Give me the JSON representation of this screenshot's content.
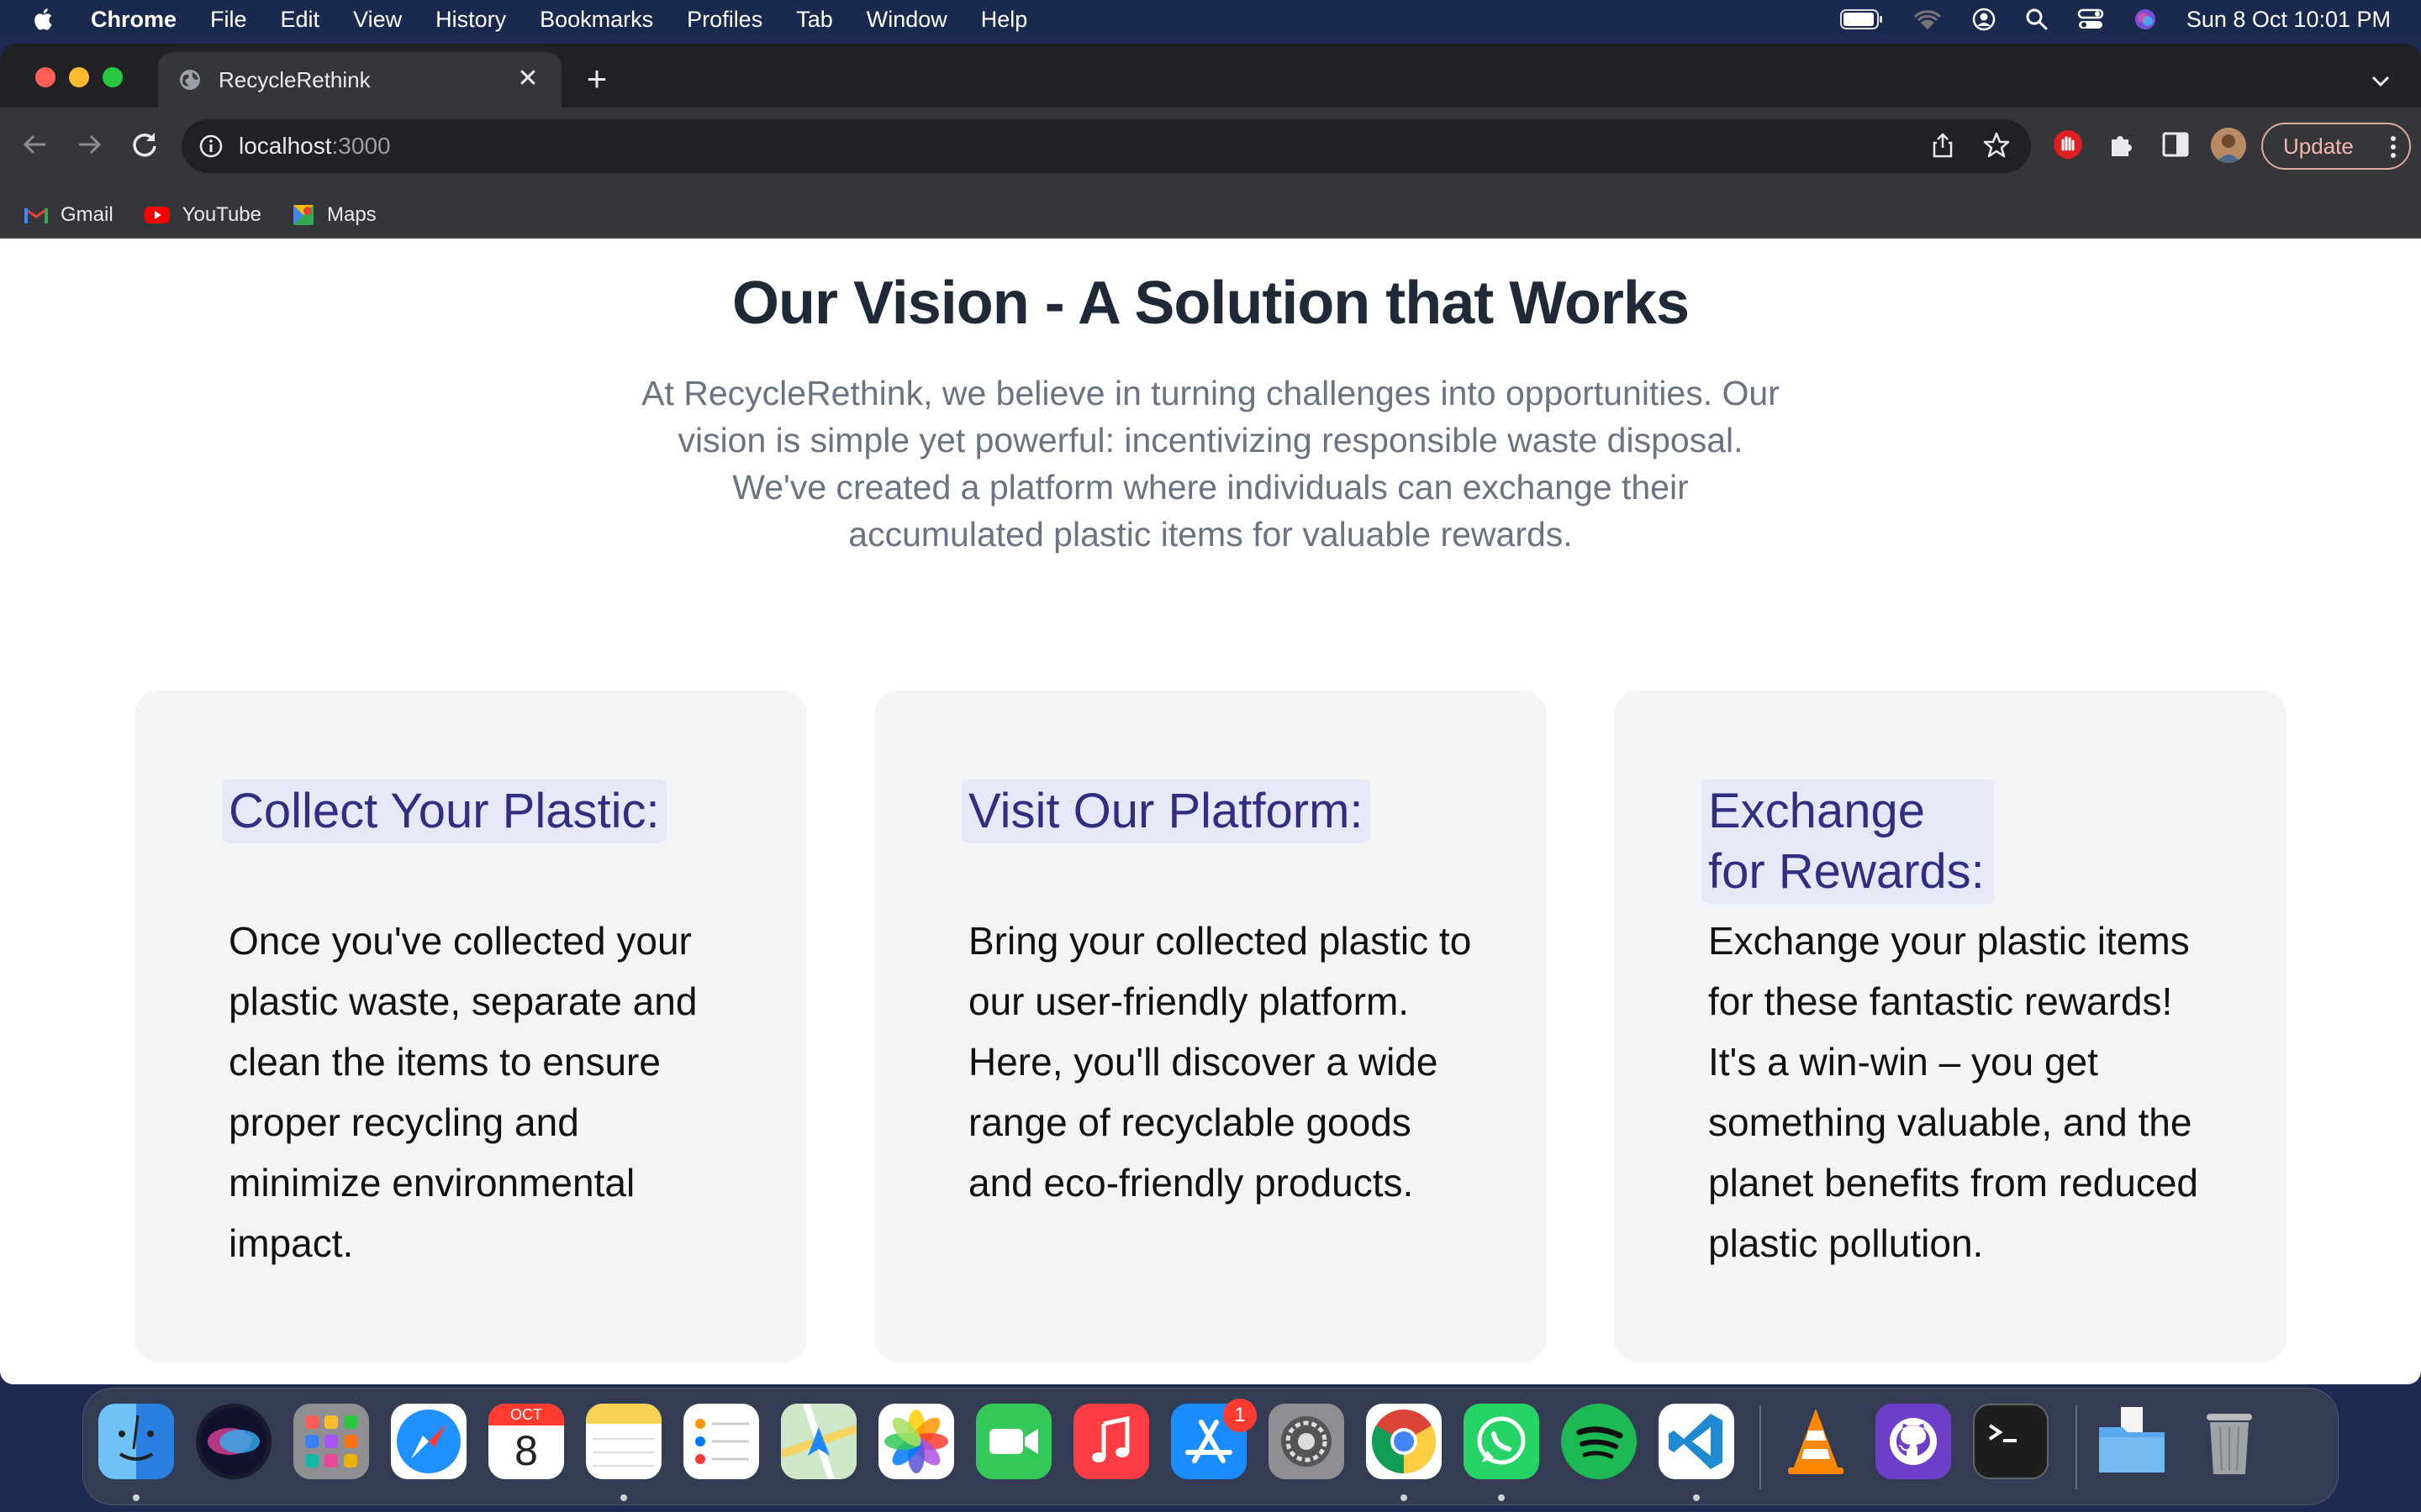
{
  "menubar": {
    "app_name": "Chrome",
    "items": [
      "File",
      "Edit",
      "View",
      "History",
      "Bookmarks",
      "Profiles",
      "Tab",
      "Window",
      "Help"
    ],
    "clock": "Sun 8 Oct  10:01 PM"
  },
  "browser": {
    "tab_title": "RecycleRethink",
    "url_host": "localhost",
    "url_port": ":3000",
    "update_label": "Update",
    "bookmarks": [
      "Gmail",
      "YouTube",
      "Maps"
    ]
  },
  "page": {
    "title": "Our Vision - A Solution that Works",
    "intro": "At RecycleRethink, we believe in turning challenges into opportunities. Our vision is simple yet powerful: incentivizing responsible waste disposal. We've created a platform where individuals can exchange their accumulated plastic items for valuable rewards.",
    "cards": [
      {
        "title": "Collect Your Plastic:",
        "body": "Once you've collected your plastic waste, separate and clean the items to ensure proper recycling and minimize environmental impact."
      },
      {
        "title": "Visit Our Platform:",
        "body": "Bring your collected plastic to our user-friendly platform. Here, you'll discover a wide range of recyclable goods and eco-friendly products."
      },
      {
        "title": "Exchange for Rewards:",
        "body": "Exchange your plastic items for these fantastic rewards! It's a win-win – you get something valuable, and the planet benefits from reduced plastic pollution."
      }
    ]
  },
  "dock": {
    "calendar_month": "OCT",
    "calendar_day": "8",
    "app_store_badge": "1",
    "apps": [
      "finder",
      "siri",
      "launchpad",
      "safari",
      "calendar",
      "notes",
      "reminders",
      "maps",
      "photos",
      "facetime",
      "music",
      "app-store",
      "system-settings",
      "chrome",
      "whatsapp",
      "spotify",
      "vscode",
      "vlc",
      "github-desktop",
      "terminal",
      "downloads-folder",
      "trash"
    ]
  }
}
